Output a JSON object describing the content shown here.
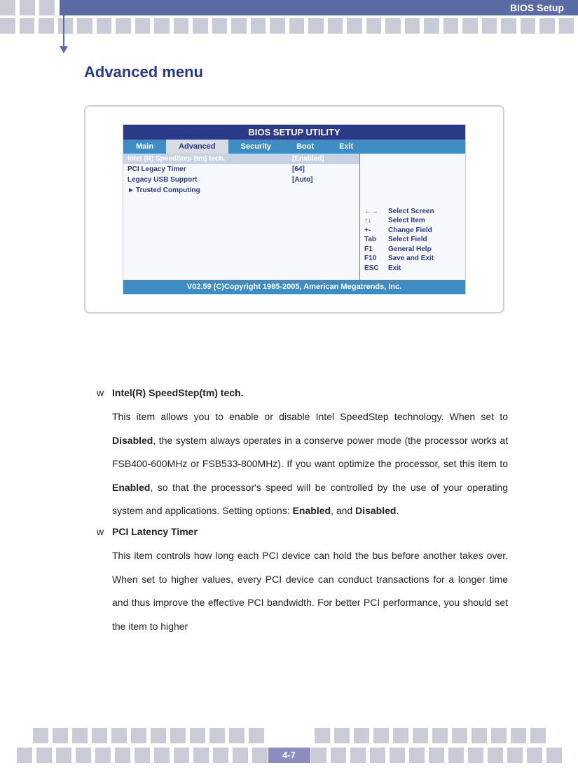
{
  "header": {
    "title": "BIOS Setup"
  },
  "section_title": "Advanced menu",
  "bios": {
    "utility_title": "BIOS SETUP UTILITY",
    "tabs": {
      "main": "Main",
      "advanced": "Advanced",
      "security": "Security",
      "boot": "Boot",
      "exit": "Exit"
    },
    "rows": {
      "speedstep": {
        "label": "Intel (R) SpeedStep (tm) tech.",
        "value": "[Enabled]"
      },
      "pci_legacy": {
        "label": "PCI Legacy Timer",
        "value": "[64]"
      },
      "legacy_usb": {
        "label": "Legacy USB Support",
        "value": "[Auto]"
      },
      "trusted": {
        "arrow": "►",
        "label": "Trusted Computing"
      }
    },
    "help": {
      "l1k": "←→",
      "l1d": "Select Screen",
      "l2k": "↑↓",
      "l2d": "Select Item",
      "l3k": "+-",
      "l3d": "Change Field",
      "l4k": "Tab",
      "l4d": "Select Field",
      "l5k": "F1",
      "l5d": "General Help",
      "l6k": "F10",
      "l6d": "Save and Exit",
      "l7k": "ESC",
      "l7d": "Exit"
    },
    "footer": "V02.59 (C)Copyright 1985-2005, American Megatrends, Inc."
  },
  "items": {
    "bullet": "w",
    "a": {
      "title": "Intel(R) SpeedStep(tm) tech.",
      "p1": "This item allows you to enable or disable Intel SpeedStep technology. When set to ",
      "b1": "Disabled",
      "p2": ", the system always operates in a conserve power mode (the processor works at FSB400-600MHz or FSB533-800MHz).   If you want optimize the processor, set this item to ",
      "b2": "Enabled",
      "p3": ", so that the processor's speed will be controlled by the use of your operating system and applications.   Setting options: ",
      "b3": "Enabled",
      "p4": ", and ",
      "b4": "Disabled",
      "p5": "."
    },
    "b": {
      "title": "PCI Latency Timer",
      "p1": "This item controls how long each PCI device can hold the bus before another takes over. When set to higher values, every PCI device can conduct transactions for a longer time and thus improve the effective PCI bandwidth. For better PCI performance, you should set the item to higher"
    }
  },
  "page_number": "4-7"
}
